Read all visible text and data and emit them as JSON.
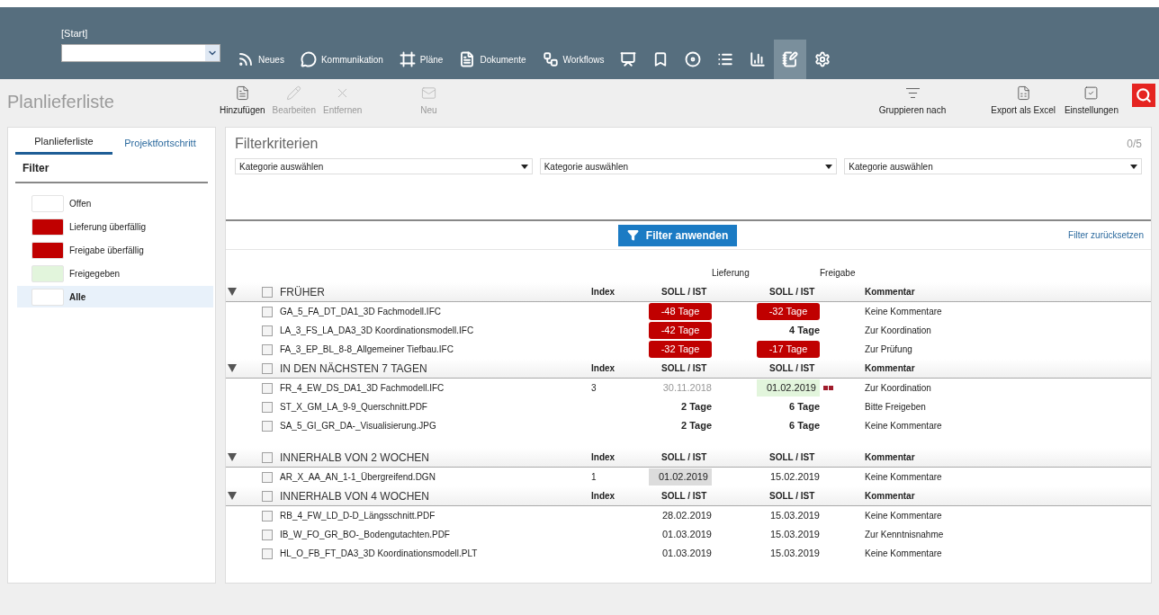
{
  "header": {
    "start_label": "[Start]",
    "nav": [
      {
        "label": "Neues",
        "selected": false
      },
      {
        "label": "Kommunikation",
        "selected": false
      },
      {
        "label": "Pläne",
        "selected": false
      },
      {
        "label": "Dokumente",
        "selected": false
      },
      {
        "label": "Workflows",
        "selected": false
      },
      {
        "selected": false
      },
      {
        "selected": false
      },
      {
        "selected": false
      },
      {
        "selected": false
      },
      {
        "selected": false
      },
      {
        "selected": true
      },
      {
        "selected": false
      }
    ]
  },
  "page_title": "Planlieferliste",
  "toolbar": {
    "left": [
      {
        "label": "Hinzufügen",
        "disabled": false
      },
      {
        "label": "Bearbeiten",
        "disabled": true
      },
      {
        "label": "Entfernen",
        "disabled": true
      },
      {
        "label": "Neu",
        "disabled": true
      }
    ],
    "right": [
      {
        "label": "Gruppieren nach",
        "disabled": false
      },
      {
        "label": "Export als Excel",
        "disabled": false
      },
      {
        "label": "Einstellungen",
        "disabled": false
      }
    ]
  },
  "sidebar": {
    "tabs": [
      {
        "label": "Planlieferliste",
        "selected": true
      },
      {
        "label": "Projektfortschritt",
        "selected": false
      }
    ],
    "filter_title": "Filter",
    "legend": [
      {
        "label": "Offen",
        "color": "#ffffff",
        "selected": false
      },
      {
        "label": "Lieferung überfällig",
        "color": "#c00000",
        "selected": false
      },
      {
        "label": "Freigabe überfällig",
        "color": "#c00000",
        "selected": false
      },
      {
        "label": "Freigegeben",
        "color": "#e2f5dc",
        "selected": false
      },
      {
        "label": "Alle",
        "color": "#ffffff",
        "selected": true
      }
    ]
  },
  "filter": {
    "title": "Filterkriterien",
    "count": "0/5",
    "selects": [
      {
        "placeholder": "Kategorie auswählen"
      },
      {
        "placeholder": "Kategorie auswählen"
      },
      {
        "placeholder": "Kategorie auswählen"
      }
    ],
    "apply": "Filter anwenden",
    "reset": "Filter zurücksetzen"
  },
  "table": {
    "super_headers": [
      "Lieferung",
      "Freigabe"
    ],
    "groups": [
      {
        "title": "FRÜHER",
        "expanded": true,
        "checked": false,
        "columns": [
          "Index",
          "SOLL / IST",
          "SOLL / IST",
          "Kommentar"
        ],
        "rows": [
          {
            "name": "GA_5_FA_DT_DA1_3D Fachmodell.IFC",
            "checked": false,
            "index": "",
            "delivery": {
              "text": "-48 Tage",
              "kind": "overdue"
            },
            "approval": {
              "text": "-32 Tage",
              "kind": "overdue"
            },
            "comment": "Keine Kommentare"
          },
          {
            "name": "LA_3_FS_LA_DA3_3D Koordinationsmodell.IFC",
            "checked": false,
            "index": "",
            "delivery": {
              "text": "-42 Tage",
              "kind": "overdue"
            },
            "approval": {
              "text": "4 Tage",
              "kind": "days"
            },
            "comment": "Zur Koordination"
          },
          {
            "name": "FA_3_EP_BL_8-8_Allgemeiner Tiefbau.IFC",
            "checked": false,
            "index": "",
            "delivery": {
              "text": "-32 Tage",
              "kind": "overdue"
            },
            "approval": {
              "text": "-17 Tage",
              "kind": "overdue"
            },
            "comment": "Zur Prüfung"
          }
        ]
      },
      {
        "title": "IN DEN NÄCHSTEN 7 TAGEN",
        "expanded": true,
        "checked": false,
        "columns": [
          "Index",
          "SOLL / IST",
          "SOLL / IST",
          "Kommentar"
        ],
        "rows": [
          {
            "name": "FR_4_EW_DS_DA1_3D Fachmodell.IFC",
            "checked": false,
            "index": "3",
            "delivery": {
              "text": "30.11.2018",
              "kind": "past"
            },
            "approval": {
              "text": "01.02.2019",
              "kind": "approved",
              "flag": true
            },
            "comment": "Zur Koordination"
          },
          {
            "name": "ST_X_GM_LA_9-9_Querschnitt.PDF",
            "checked": false,
            "index": "",
            "delivery": {
              "text": "2 Tage",
              "kind": "days"
            },
            "approval": {
              "text": "6 Tage",
              "kind": "days"
            },
            "comment": "Bitte Freigeben"
          },
          {
            "name": "SA_5_GI_GR_DA-_Visualisierung.JPG",
            "checked": false,
            "index": "",
            "delivery": {
              "text": "2 Tage",
              "kind": "days"
            },
            "approval": {
              "text": "6 Tage",
              "kind": "days"
            },
            "comment": "Keine Kommentare"
          }
        ]
      },
      {
        "title": "INNERHALB VON 2 WOCHEN",
        "expanded": true,
        "checked": false,
        "columns": [
          "Index",
          "SOLL / IST",
          "SOLL / IST",
          "Kommentar"
        ],
        "rows": [
          {
            "name": "AR_X_AA_AN_1-1_Übergreifend.DGN",
            "checked": false,
            "index": "1",
            "delivery": {
              "text": "01.02.2019",
              "kind": "highlight"
            },
            "approval": {
              "text": "15.02.2019",
              "kind": "date"
            },
            "comment": "Keine Kommentare"
          }
        ]
      },
      {
        "title": "INNERHALB VON 4 WOCHEN",
        "expanded": true,
        "checked": false,
        "columns": [
          "Index",
          "SOLL / IST",
          "SOLL / IST",
          "Kommentar"
        ],
        "rows": [
          {
            "name": "RB_4_FW_LD_D-D_Längsschnitt.PDF",
            "checked": false,
            "index": "",
            "delivery": {
              "text": "28.02.2019",
              "kind": "date"
            },
            "approval": {
              "text": "15.03.2019",
              "kind": "date"
            },
            "comment": "Keine Kommentare"
          },
          {
            "name": "IB_W_FO_GR_BO-_Bodengutachten.PDF",
            "checked": false,
            "index": "",
            "delivery": {
              "text": "01.03.2019",
              "kind": "date"
            },
            "approval": {
              "text": "15.03.2019",
              "kind": "date"
            },
            "comment": "Zur Kenntnisnahme"
          },
          {
            "name": "HL_O_FB_FT_DA3_3D Koordinationsmodell.PLT",
            "checked": false,
            "index": "",
            "delivery": {
              "text": "01.03.2019",
              "kind": "date"
            },
            "approval": {
              "text": "15.03.2019",
              "kind": "date"
            },
            "comment": "Keine Kommentare"
          }
        ]
      }
    ]
  }
}
